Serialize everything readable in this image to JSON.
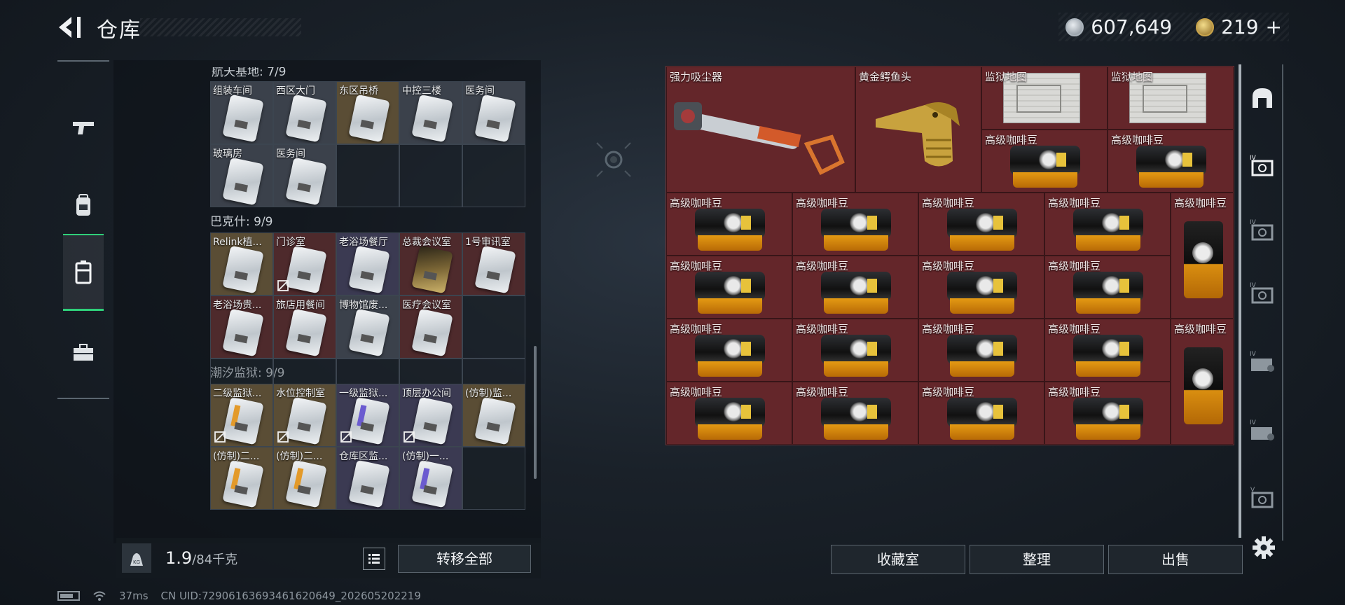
{
  "header": {
    "title": "仓库",
    "currency_silver": "607,649",
    "currency_gold": "219",
    "currency_gold_plus": "+"
  },
  "left_inventory": {
    "groups": [
      {
        "label": "航天基地: 7/9",
        "items": [
          {
            "label": "组装车间",
            "color": "grey",
            "card": "plain",
            "bound": false
          },
          {
            "label": "西区大门",
            "color": "grey",
            "card": "plain",
            "bound": false
          },
          {
            "label": "东区吊桥",
            "color": "gold",
            "card": "plain",
            "bound": false
          },
          {
            "label": "中控三楼",
            "color": "grey",
            "card": "plain",
            "bound": false
          },
          {
            "label": "医务间",
            "color": "grey",
            "card": "plain",
            "bound": false
          },
          {
            "label": "玻璃房",
            "color": "grey",
            "card": "plain",
            "bound": false
          },
          {
            "label": "医务间",
            "color": "grey",
            "card": "plain",
            "bound": false
          }
        ]
      },
      {
        "label": "巴克什: 9/9",
        "items": [
          {
            "label": "Relink植...",
            "color": "gold",
            "card": "plain",
            "bound": false
          },
          {
            "label": "门诊室",
            "color": "red",
            "card": "plain",
            "bound": true
          },
          {
            "label": "老浴场餐厅",
            "color": "purple",
            "card": "plain",
            "bound": false
          },
          {
            "label": "总裁会议室",
            "color": "red",
            "card": "goldcard",
            "bound": false
          },
          {
            "label": "1号审讯室",
            "color": "red",
            "card": "plain",
            "bound": false
          },
          {
            "label": "老浴场贵...",
            "color": "red",
            "card": "plain",
            "bound": false
          },
          {
            "label": "旅店用餐间",
            "color": "red",
            "card": "plain",
            "bound": false
          },
          {
            "label": "博物馆废...",
            "color": "grey",
            "card": "plain",
            "bound": false
          },
          {
            "label": "医疗会议室",
            "color": "red",
            "card": "plain",
            "bound": false
          }
        ]
      },
      {
        "label": "潮汐监狱: 9/9",
        "items": [
          {
            "label": "二级监狱...",
            "color": "gold",
            "card": "stripe",
            "bound": true
          },
          {
            "label": "水位控制室",
            "color": "gold",
            "card": "plain",
            "bound": true
          },
          {
            "label": "一级监狱...",
            "color": "purple",
            "card": "stripe",
            "bound": true
          },
          {
            "label": "顶层办公间",
            "color": "purple",
            "card": "plain",
            "bound": true
          },
          {
            "label": "(仿制)监...",
            "color": "gold",
            "card": "plain",
            "bound": false
          },
          {
            "label": "(仿制)二...",
            "color": "gold",
            "card": "stripe",
            "bound": false
          },
          {
            "label": "(仿制)二...",
            "color": "gold",
            "card": "stripe",
            "bound": false
          },
          {
            "label": "仓库区监...",
            "color": "purple",
            "card": "plain",
            "bound": false
          },
          {
            "label": "(仿制)一...",
            "color": "purple",
            "card": "stripe",
            "bound": false
          }
        ]
      }
    ],
    "weight_current": "1.9",
    "weight_max": "/84千克",
    "transfer_all_label": "转移全部"
  },
  "right_stash": {
    "items": {
      "vacuum": "强力吸尘器",
      "croc_head": "黄金鳄鱼头",
      "prison_map": "监狱地图",
      "coffee": "高级咖啡豆"
    }
  },
  "bottom_buttons": {
    "collection": "收藏室",
    "organize": "整理",
    "sell": "出售"
  },
  "statusbar": {
    "ping": "37ms",
    "uid": "CN UID:7290616369346162064​9_202605202219"
  },
  "colors": {
    "accent_green": "#2fd07a",
    "stash_red": "#5a2428",
    "gold": "#c9a44b"
  },
  "icons": {
    "left_rail": [
      "pistol-icon",
      "backpack-icon",
      "storage-case-icon",
      "toolbox-icon"
    ],
    "right_rail": [
      "arch-icon",
      "tier4-card-icon",
      "tier4-card-icon",
      "tier4-card-icon",
      "tier4-case-icon",
      "tier4-case-icon",
      "tier5-card-icon"
    ]
  }
}
